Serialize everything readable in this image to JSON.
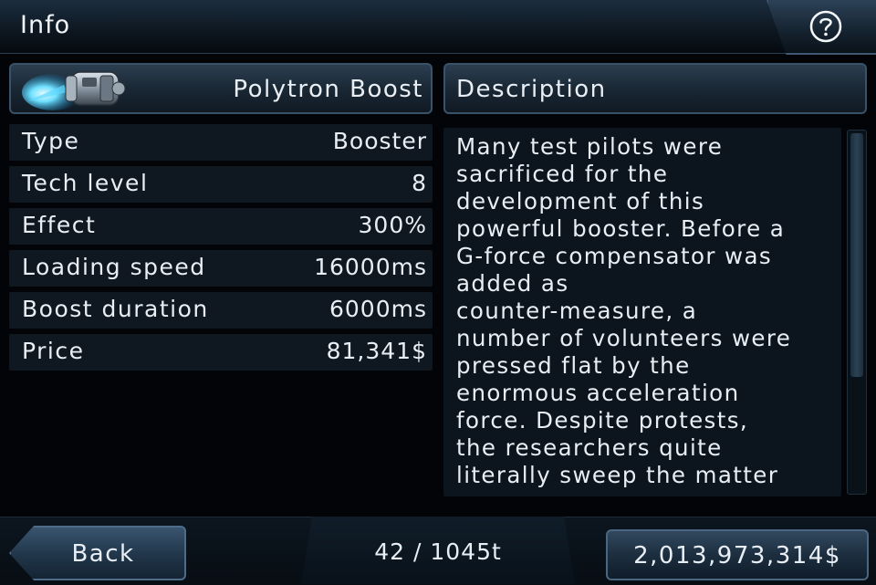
{
  "header": {
    "title": "Info",
    "help_icon": "question-circle-icon"
  },
  "item": {
    "name": "Polytron Boost",
    "icon": "booster-engine-icon"
  },
  "stats": [
    {
      "label": "Type",
      "value": "Booster"
    },
    {
      "label": "Tech level",
      "value": "8"
    },
    {
      "label": "Effect",
      "value": "300%"
    },
    {
      "label": "Loading speed",
      "value": "16000ms"
    },
    {
      "label": "Boost duration",
      "value": "6000ms"
    },
    {
      "label": "Price",
      "value": "81,341$"
    }
  ],
  "description": {
    "title": "Description",
    "text": "Many test pilots were\nsacrificed for the\ndevelopment of this\npowerful booster. Before a\nG-force compensator was\nadded as\ncounter-measure, a\nnumber of volunteers were\npressed flat by the\nenormous acceleration\nforce. Despite protests,\nthe researchers quite\nliterally sweep the matter",
    "scroll_fraction_visible": 0.68
  },
  "footer": {
    "back_label": "Back",
    "capacity": "42 / 1045t",
    "money": "2,013,973,314$"
  },
  "colors": {
    "accent": "#3a5268",
    "glow": "#4fd4ff"
  }
}
